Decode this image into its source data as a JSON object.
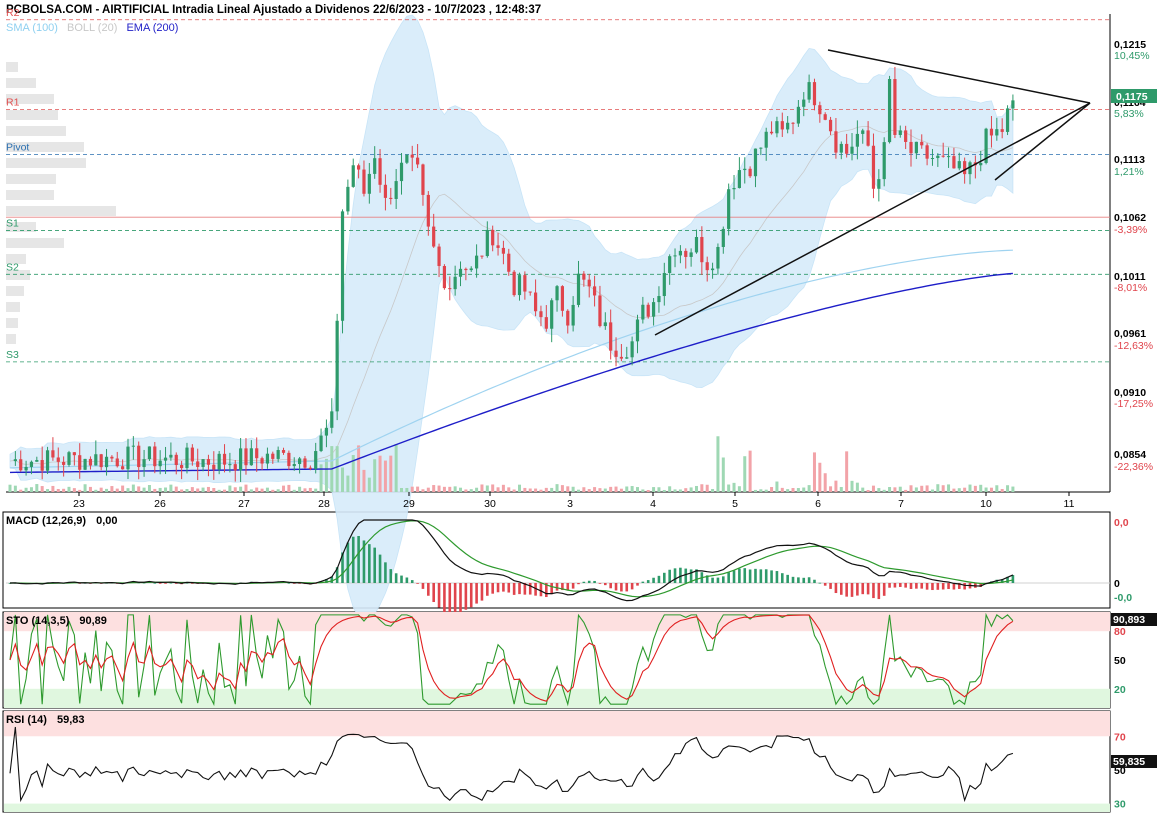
{
  "header": {
    "title": "PCBOLSA.COM - AIRTIFICIAL Intradia Lineal Ajustado a Dividenos 22/6/2023 - 10/7/2023 , 12:48:37",
    "legend": [
      {
        "label": "SMA (100)",
        "color": "#8fd0f0"
      },
      {
        "label": "BOLL (20)",
        "color": "#c8c8c8"
      },
      {
        "label": "EMA (200)",
        "color": "#2323c8"
      }
    ]
  },
  "colors": {
    "up": "#2e9a6a",
    "down": "#e0444c",
    "boll_fill": "#d6ecfa",
    "sma": "#9fd3f0",
    "ema": "#1e1ec8",
    "res": "#e05050",
    "sup": "#2e9a6a",
    "pivot": "#2a6fb0"
  },
  "price_panel": {
    "y_ticks": [
      "0,1215",
      "0,1113",
      "0,1062",
      "0,1011",
      "0,0961",
      "0,0910",
      "0,0854"
    ],
    "pct_ticks": [
      "10,45%",
      "5,83%",
      "1,21%",
      "-3,39%",
      "-8,01%",
      "-12,63%",
      "-17,25%",
      "-22,36%"
    ],
    "last_price_tag": "0,1175",
    "extra_label": "0,1164",
    "levels": [
      "R2",
      "R1",
      "Pivot",
      "S1",
      "S2",
      "S3"
    ],
    "x_labels": [
      "23",
      "26",
      "27",
      "28",
      "29",
      "30",
      "3",
      "4",
      "5",
      "6",
      "7",
      "10",
      "11"
    ]
  },
  "macd_panel": {
    "label": "MACD (12,26,9)",
    "value": "0,00",
    "y_ticks": [
      "0,0",
      "0",
      "-0,0"
    ]
  },
  "sto_panel": {
    "label": "STO (14,3,5)",
    "value": "90,89",
    "y_ticks": [
      "80",
      "50",
      "20"
    ],
    "tag": "90,893"
  },
  "rsi_panel": {
    "label": "RSI (14)",
    "value": "59,83",
    "y_ticks": [
      "70",
      "50",
      "30"
    ],
    "tag": "59,835"
  },
  "chart_data": {
    "type": "candlestick",
    "title": "PCBOLSA.COM - AIRTIFICIAL Intradia Lineal Ajustado a Dividenos 22/6/2023 - 10/7/2023 , 12:48:37",
    "x_labels": [
      "23",
      "26",
      "27",
      "28",
      "29",
      "30",
      "3",
      "4",
      "5",
      "6",
      "7",
      "10",
      "11"
    ],
    "ylim": [
      0.0835,
      0.125
    ],
    "last_close": 0.1175,
    "levels": {
      "R2": 0.1245,
      "R1": 0.1167,
      "Pivot": 0.1128,
      "S1": 0.1062,
      "S2": 0.1024,
      "S3": 0.0948
    },
    "anchors": [
      [
        0,
        0.0862
      ],
      [
        8,
        0.0863
      ],
      [
        16,
        0.0864
      ],
      [
        24,
        0.0865
      ],
      [
        32,
        0.0863
      ],
      [
        40,
        0.0862
      ],
      [
        48,
        0.0866
      ],
      [
        56,
        0.0865
      ],
      [
        60,
        0.0895
      ],
      [
        62,
        0.108
      ],
      [
        64,
        0.112
      ],
      [
        66,
        0.1095
      ],
      [
        68,
        0.113
      ],
      [
        70,
        0.1085
      ],
      [
        72,
        0.111
      ],
      [
        74,
        0.112
      ],
      [
        76,
        0.111
      ],
      [
        78,
        0.106
      ],
      [
        80,
        0.103
      ],
      [
        82,
        0.1015
      ],
      [
        84,
        0.1035
      ],
      [
        86,
        0.1025
      ],
      [
        88,
        0.1045
      ],
      [
        90,
        0.106
      ],
      [
        92,
        0.104
      ],
      [
        94,
        0.1015
      ],
      [
        96,
        0.101
      ],
      [
        98,
        0.099
      ],
      [
        100,
        0.0985
      ],
      [
        102,
        0.1005
      ],
      [
        104,
        0.099
      ],
      [
        106,
        0.102
      ],
      [
        108,
        0.101
      ],
      [
        110,
        0.0985
      ],
      [
        112,
        0.0965
      ],
      [
        114,
        0.096
      ],
      [
        116,
        0.0965
      ],
      [
        118,
        0.099
      ],
      [
        120,
        0.1
      ],
      [
        122,
        0.103
      ],
      [
        124,
        0.105
      ],
      [
        126,
        0.1045
      ],
      [
        128,
        0.105
      ],
      [
        130,
        0.1035
      ],
      [
        132,
        0.1045
      ],
      [
        134,
        0.11
      ],
      [
        136,
        0.1115
      ],
      [
        138,
        0.112
      ],
      [
        140,
        0.1135
      ],
      [
        142,
        0.115
      ],
      [
        144,
        0.1145
      ],
      [
        146,
        0.116
      ],
      [
        148,
        0.1185
      ],
      [
        150,
        0.118
      ],
      [
        152,
        0.1165
      ],
      [
        154,
        0.114
      ],
      [
        156,
        0.113
      ],
      [
        158,
        0.1145
      ],
      [
        160,
        0.1135
      ],
      [
        161,
        0.11
      ],
      [
        163,
        0.113
      ],
      [
        164,
        0.119
      ],
      [
        165,
        0.1145
      ],
      [
        168,
        0.113
      ],
      [
        172,
        0.1125
      ],
      [
        176,
        0.1115
      ],
      [
        178,
        0.1108
      ],
      [
        180,
        0.112
      ],
      [
        182,
        0.114
      ],
      [
        185,
        0.115
      ],
      [
        187,
        0.1175
      ]
    ],
    "volume_note": "volume bars shown in price panel (no scale)",
    "macd": {
      "line": "black",
      "signal": "green",
      "histogram": true
    },
    "stochastic": {
      "k": "green",
      "d": "red",
      "last": 90.893,
      "ylim": [
        0,
        100
      ]
    },
    "rsi": {
      "last": 59.835,
      "ylim": [
        25,
        85
      ]
    }
  }
}
